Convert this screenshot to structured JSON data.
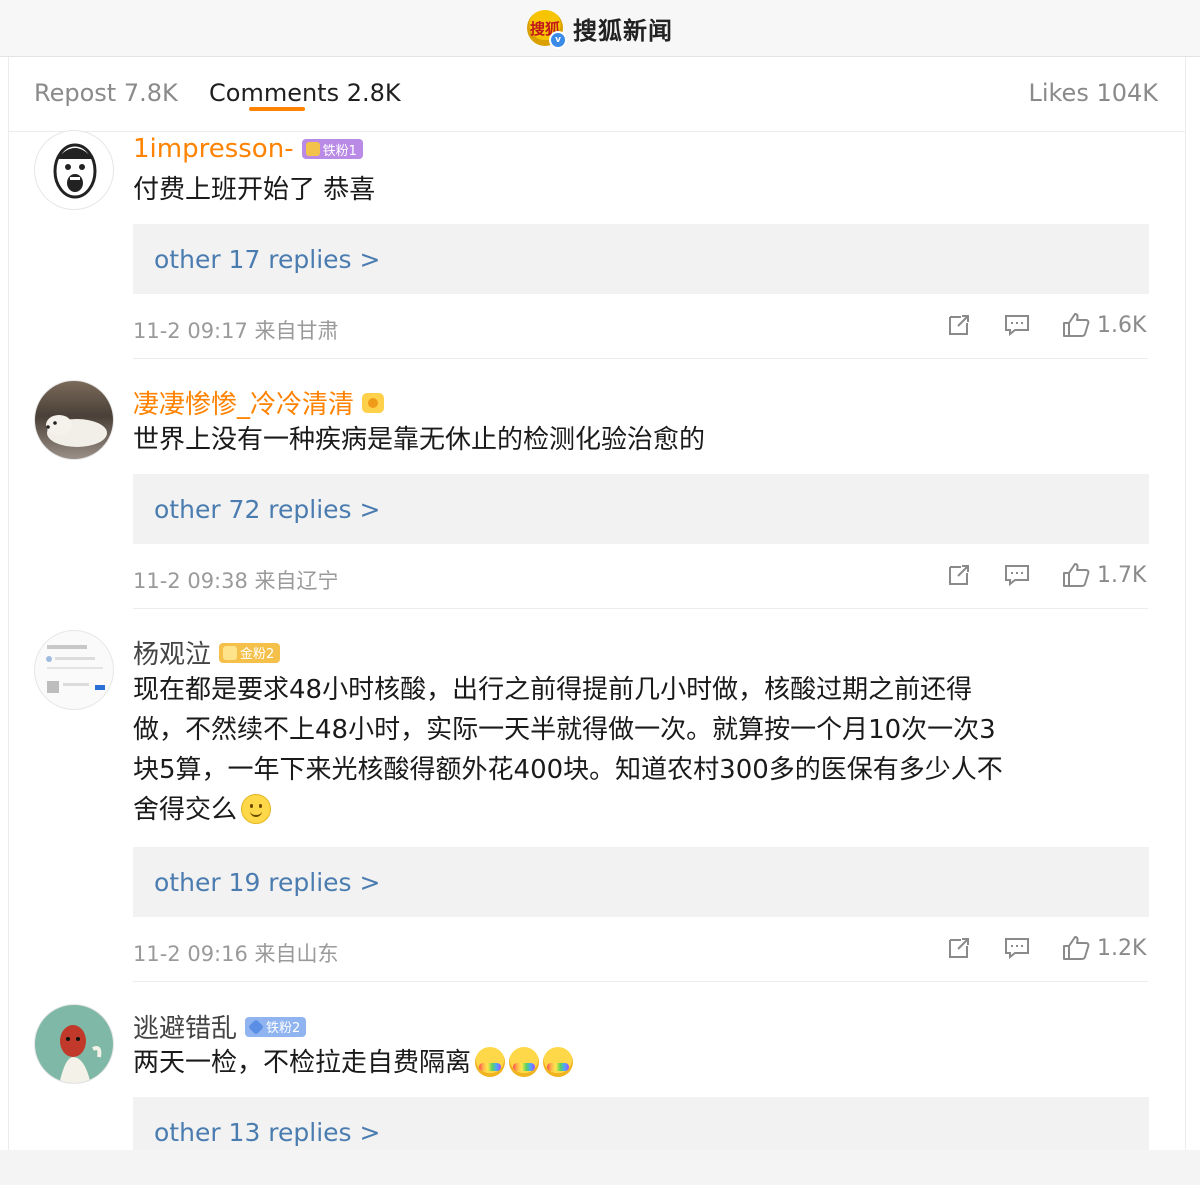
{
  "header": {
    "logo_text": "搜狐",
    "title": "搜狐新闻"
  },
  "tabs": {
    "repost": "Repost 7.8K",
    "comments": "Comments 2.8K",
    "likes": "Likes 104K"
  },
  "comments": [
    {
      "user": "1impresson-",
      "badge": "铁粉1",
      "text": "付费上班开始了 恭喜",
      "replies": "other 17 replies >",
      "meta": "11-2 09:17 来自甘肃",
      "likes": "1.6K"
    },
    {
      "user": "凄凄惨惨_冷冷清清",
      "text": "世界上没有一种疾病是靠无休止的检测化验治愈的",
      "replies": "other 72 replies >",
      "meta": "11-2 09:38 来自辽宁",
      "likes": "1.7K"
    },
    {
      "user": "杨观泣",
      "badge": "金粉2",
      "text_lines": [
        "现在都是要求48小时核酸，出行之前得提前几小时做，核酸过期之前还得",
        "做，不然续不上48小时，实际一天半就得做一次。就算按一个月10次一次3",
        "块5算，一年下来光核酸得额外花400块。知道农村300多的医保有多少人不",
        "舍得交么"
      ],
      "replies": "other 19 replies >",
      "meta": "11-2 09:16 来自山东",
      "likes": "1.2K"
    },
    {
      "user": "逃避错乱",
      "badge": "铁粉2",
      "text": "两天一检，不检拉走自费隔离",
      "replies": "other 13 replies >"
    }
  ],
  "colors": {
    "accent": "#ff8200",
    "link": "#4a7cb0"
  },
  "icons": [
    "repost-icon",
    "comment-icon",
    "like-icon",
    "smile-emoji",
    "rainbow-barf-emoji"
  ]
}
